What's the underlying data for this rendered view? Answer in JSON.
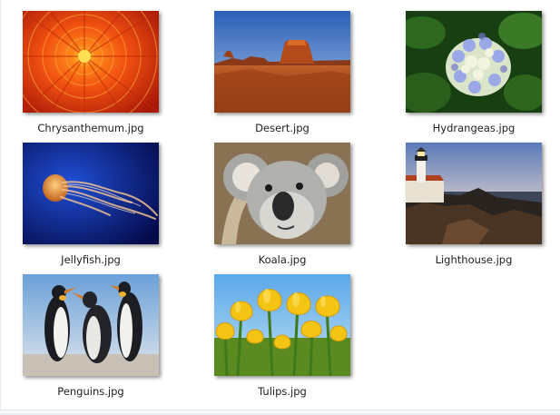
{
  "files": [
    {
      "name": "Chrysanthemum.jpg",
      "icon": "chrysanthemum-thumbnail-icon"
    },
    {
      "name": "Desert.jpg",
      "icon": "desert-thumbnail-icon"
    },
    {
      "name": "Hydrangeas.jpg",
      "icon": "hydrangeas-thumbnail-icon"
    },
    {
      "name": "Jellyfish.jpg",
      "icon": "jellyfish-thumbnail-icon"
    },
    {
      "name": "Koala.jpg",
      "icon": "koala-thumbnail-icon"
    },
    {
      "name": "Lighthouse.jpg",
      "icon": "lighthouse-thumbnail-icon"
    },
    {
      "name": "Penguins.jpg",
      "icon": "penguins-thumbnail-icon"
    },
    {
      "name": "Tulips.jpg",
      "icon": "tulips-thumbnail-icon"
    }
  ]
}
